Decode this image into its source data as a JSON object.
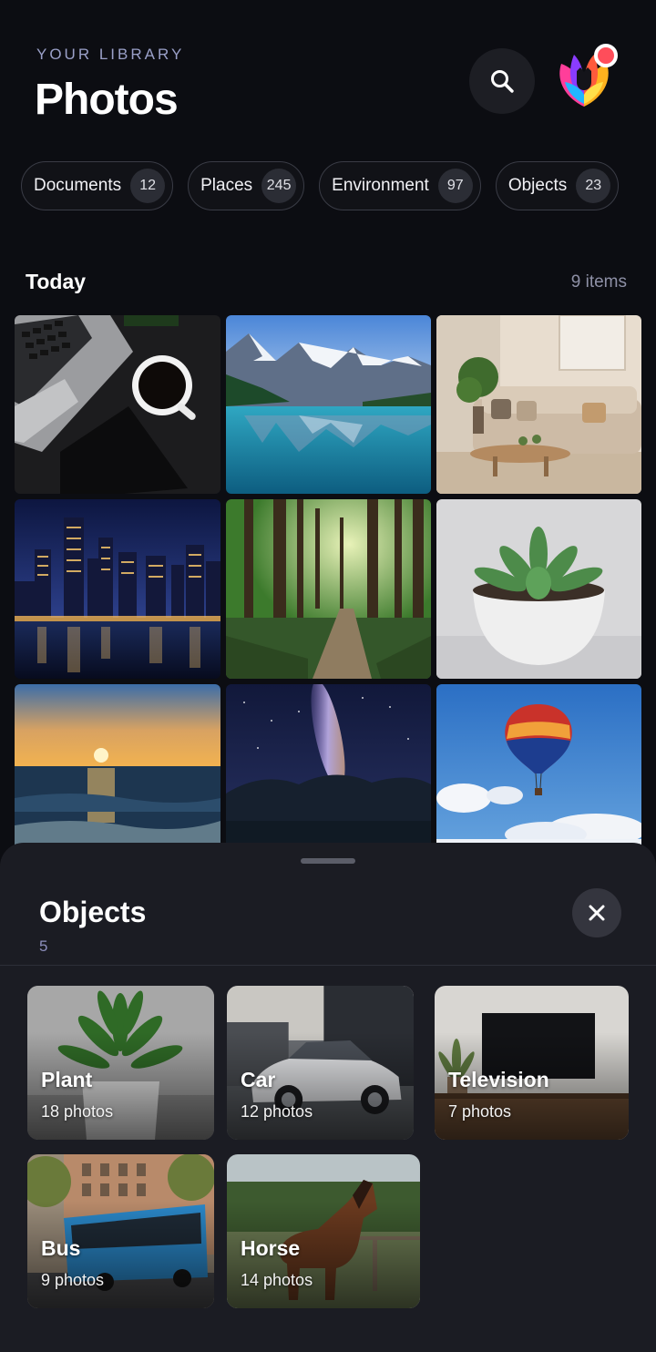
{
  "header": {
    "eyebrow": "YOUR LIBRARY",
    "title": "Photos",
    "icons": {
      "search": "search-icon",
      "logo": "app-logo"
    },
    "notification_color": "#ff4d5a"
  },
  "chips": [
    {
      "label": "Documents",
      "count": "12"
    },
    {
      "label": "Places",
      "count": "245"
    },
    {
      "label": "Environment",
      "count": "97"
    },
    {
      "label": "Objects",
      "count": "23"
    }
  ],
  "today": {
    "title": "Today",
    "count_label": "9 items",
    "photos": [
      "laptop-coffee",
      "mountain-lake",
      "living-room",
      "city-night",
      "forest-path",
      "succulent",
      "ocean-sunset",
      "milky-way",
      "hot-air-balloon"
    ]
  },
  "sheet": {
    "title": "Objects",
    "count": "5",
    "close_icon": "close-icon",
    "items": [
      {
        "name": "Plant",
        "count_label": "18 photos"
      },
      {
        "name": "Car",
        "count_label": "12 photos"
      },
      {
        "name": "Television",
        "count_label": "7 photos"
      },
      {
        "name": "Bus",
        "count_label": "9 photos"
      },
      {
        "name": "Horse",
        "count_label": "14 photos"
      }
    ]
  },
  "colors": {
    "background": "#0c0d12",
    "sheet": "#1b1c23",
    "accent_text": "#9aa0c8"
  }
}
